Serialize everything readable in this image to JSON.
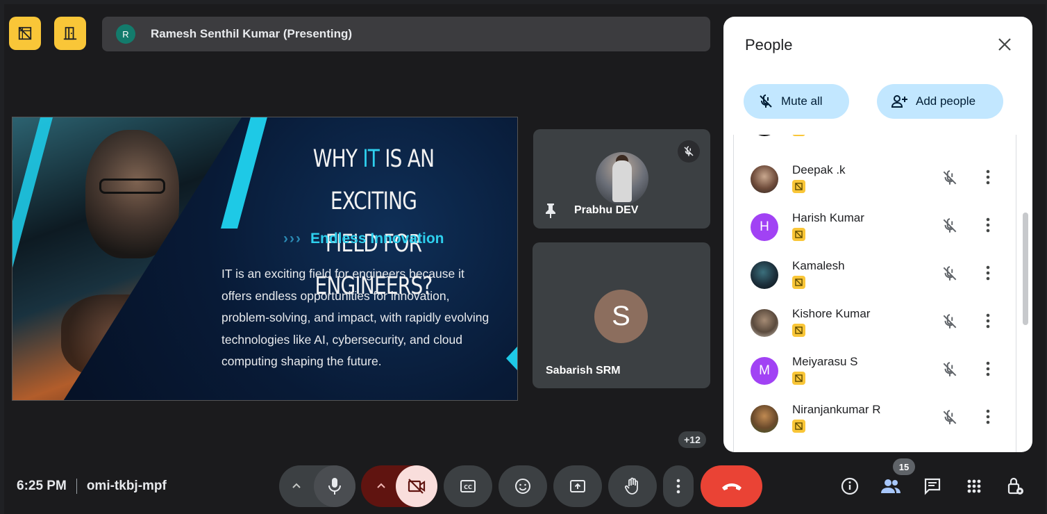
{
  "header": {
    "presenter_initial": "R",
    "presenter_label": "Ramesh Senthil Kumar (Presenting)"
  },
  "host_controls": [
    {
      "icon": "host-controls-icon"
    },
    {
      "icon": "exit-door-icon"
    }
  ],
  "slide": {
    "title_pre": "WHY ",
    "title_accent": "IT",
    "title_post": " IS AN EXCITING",
    "title_line2": "FIELD FOR ENGINEERS?",
    "subtitle": "Endless Innovation",
    "body": "IT is an exciting field for engineers because it offers endless opportunities for innovation, problem-solving, and impact, with rapidly evolving technologies like AI, cybersecurity, and cloud computing shaping the future."
  },
  "tiles": [
    {
      "name": "Prabhu DEV",
      "pinned": true,
      "muted": true
    },
    {
      "name": "Sabarish SRM",
      "initial": "S"
    }
  ],
  "more_participants": "+12",
  "people_panel": {
    "title": "People",
    "mute_all": "Mute all",
    "add_people": "Add people",
    "people": [
      {
        "name": "Deepak .k",
        "avatar": "photo"
      },
      {
        "name": "Harish Kumar",
        "initial": "H",
        "avatar_color": "#a142f4"
      },
      {
        "name": "Kamalesh",
        "avatar": "photo"
      },
      {
        "name": "Kishore Kumar",
        "avatar": "photo"
      },
      {
        "name": "Meiyarasu S",
        "initial": "M",
        "avatar_color": "#a142f4"
      },
      {
        "name": "Niranjankumar R",
        "avatar": "photo"
      }
    ]
  },
  "bottom_bar": {
    "time": "6:25 PM",
    "meeting_code": "omi-tkbj-mpf",
    "participant_count": "15",
    "accent_end_call": "#ea4335",
    "accent_camera_off": "#f9dedc"
  }
}
